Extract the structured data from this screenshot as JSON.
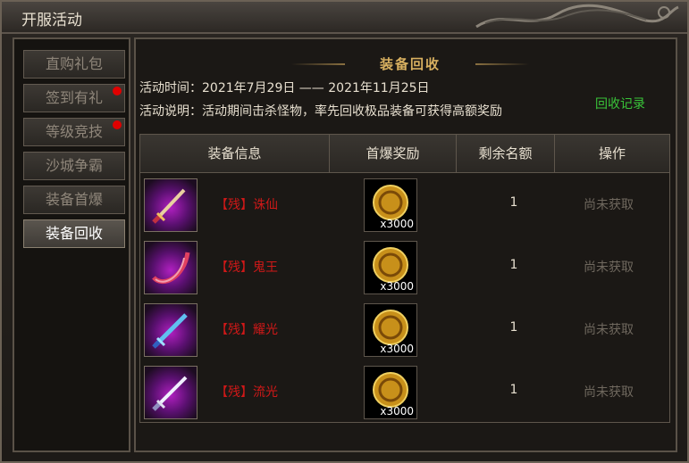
{
  "window": {
    "title": "开服活动"
  },
  "sidebar": {
    "items": [
      {
        "label": "直购礼包",
        "badge": false
      },
      {
        "label": "签到有礼",
        "badge": true
      },
      {
        "label": "等级竞技",
        "badge": true
      },
      {
        "label": "沙城争霸",
        "badge": false
      },
      {
        "label": "装备首爆",
        "badge": false
      },
      {
        "label": "装备回收",
        "badge": false,
        "active": true
      }
    ]
  },
  "main": {
    "heading": "装备回收",
    "time_label": "活动时间：2021年7月29日 —— 2021年11月25日",
    "desc_label": "活动说明：活动期间击杀怪物，率先回收极品装备可获得高额奖励",
    "record_link": "回收记录",
    "table": {
      "headers": [
        "装备信息",
        "首爆奖励",
        "剩余名额",
        "操作"
      ],
      "rows": [
        {
          "name": "【残】诛仙",
          "reward_qty": "x3000",
          "remaining": "1",
          "status": "尚未获取",
          "icon": "sword-icon"
        },
        {
          "name": "【残】鬼王",
          "reward_qty": "x3000",
          "remaining": "1",
          "status": "尚未获取",
          "icon": "curved-blade-icon"
        },
        {
          "name": "【残】耀光",
          "reward_qty": "x3000",
          "remaining": "1",
          "status": "尚未获取",
          "icon": "sword-icon"
        },
        {
          "name": "【残】流光",
          "reward_qty": "x3000",
          "remaining": "1",
          "status": "尚未获取",
          "icon": "sword-icon"
        }
      ]
    }
  },
  "colors": {
    "item_name": "#d01818",
    "record_link": "#39c439",
    "heading": "#d8b060",
    "badge": "#e00000"
  }
}
